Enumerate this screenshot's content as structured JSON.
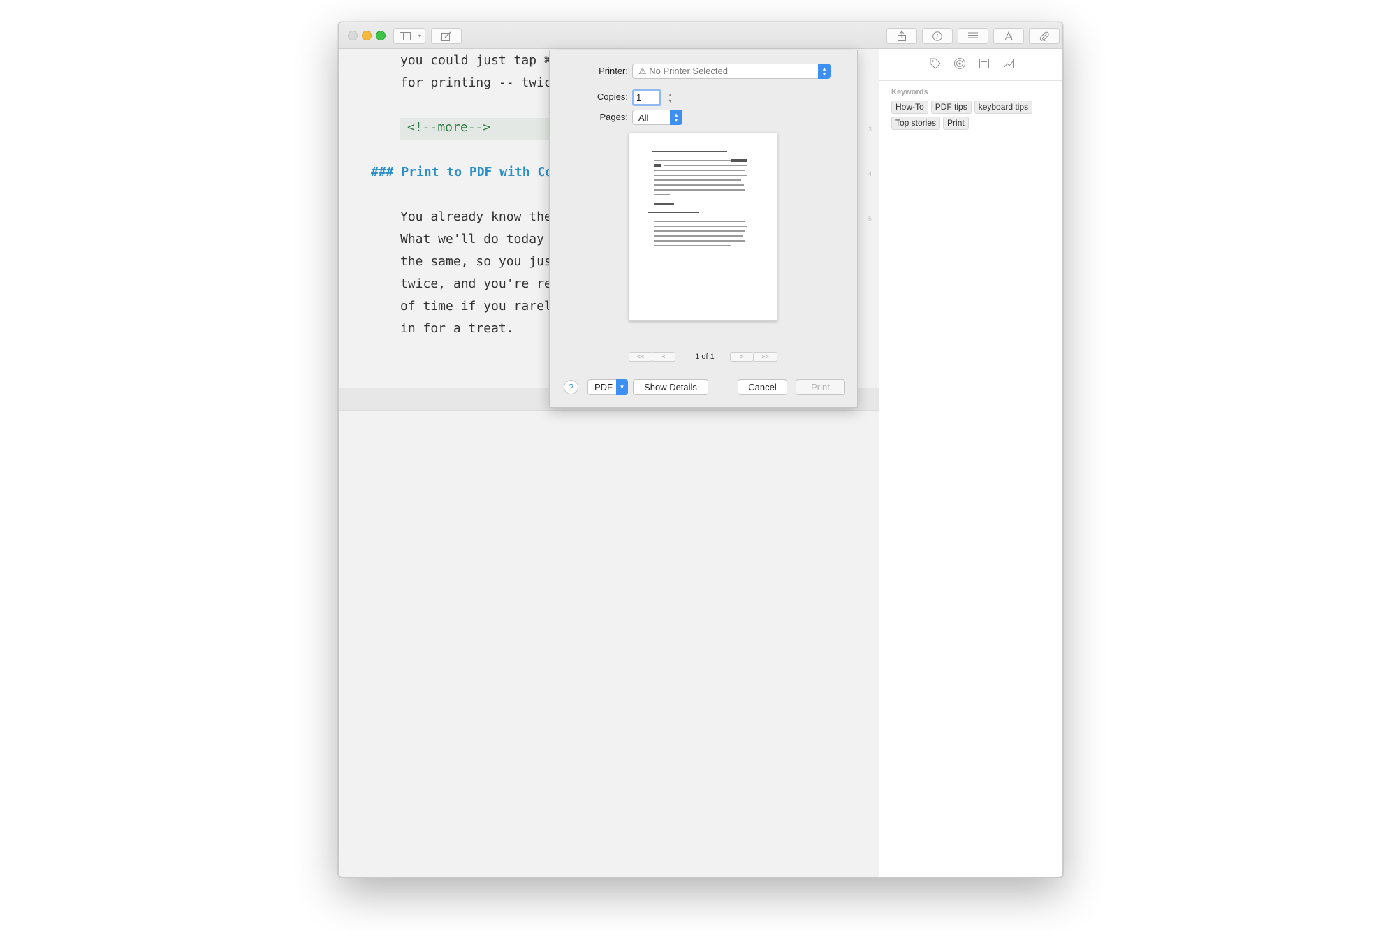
{
  "titlebar": {
    "left_tools": [
      "sidebar-toggle-icon",
      "chevron-down-icon",
      "compose-icon"
    ],
    "right_tools": [
      "share-icon",
      "info-icon",
      "list-icon",
      "font-icon",
      "attachment-icon"
    ]
  },
  "editor": {
    "lines": [
      "you could just tap ⌘",
      "for printing -- twice",
      "<!--more-->",
      "### Print to PDF with Cor",
      "You already know the",
      "What we'll do today i",
      "the same, so you just",
      "twice, and you're rea",
      "of time if you rarely",
      "in for a treat."
    ],
    "line_numbers": [
      "3",
      "4",
      "5"
    ]
  },
  "sidebar": {
    "icons": [
      "tag-icon",
      "target-icon",
      "document-icon",
      "image-icon"
    ],
    "keywords_label": "Keywords",
    "tags": [
      "How-To",
      "PDF tips",
      "keyboard tips",
      "Top stories",
      "Print"
    ]
  },
  "print_dialog": {
    "printer_label": "Printer:",
    "printer_value": "⚠ No Printer Selected",
    "copies_label": "Copies:",
    "copies_value": "1",
    "pages_label": "Pages:",
    "pages_value": "All",
    "page_indicator": "1 of 1",
    "help_label": "?",
    "pdf_label": "PDF",
    "show_details_label": "Show Details",
    "cancel_label": "Cancel",
    "print_label": "Print",
    "accent_color": "#3d8ff2"
  }
}
